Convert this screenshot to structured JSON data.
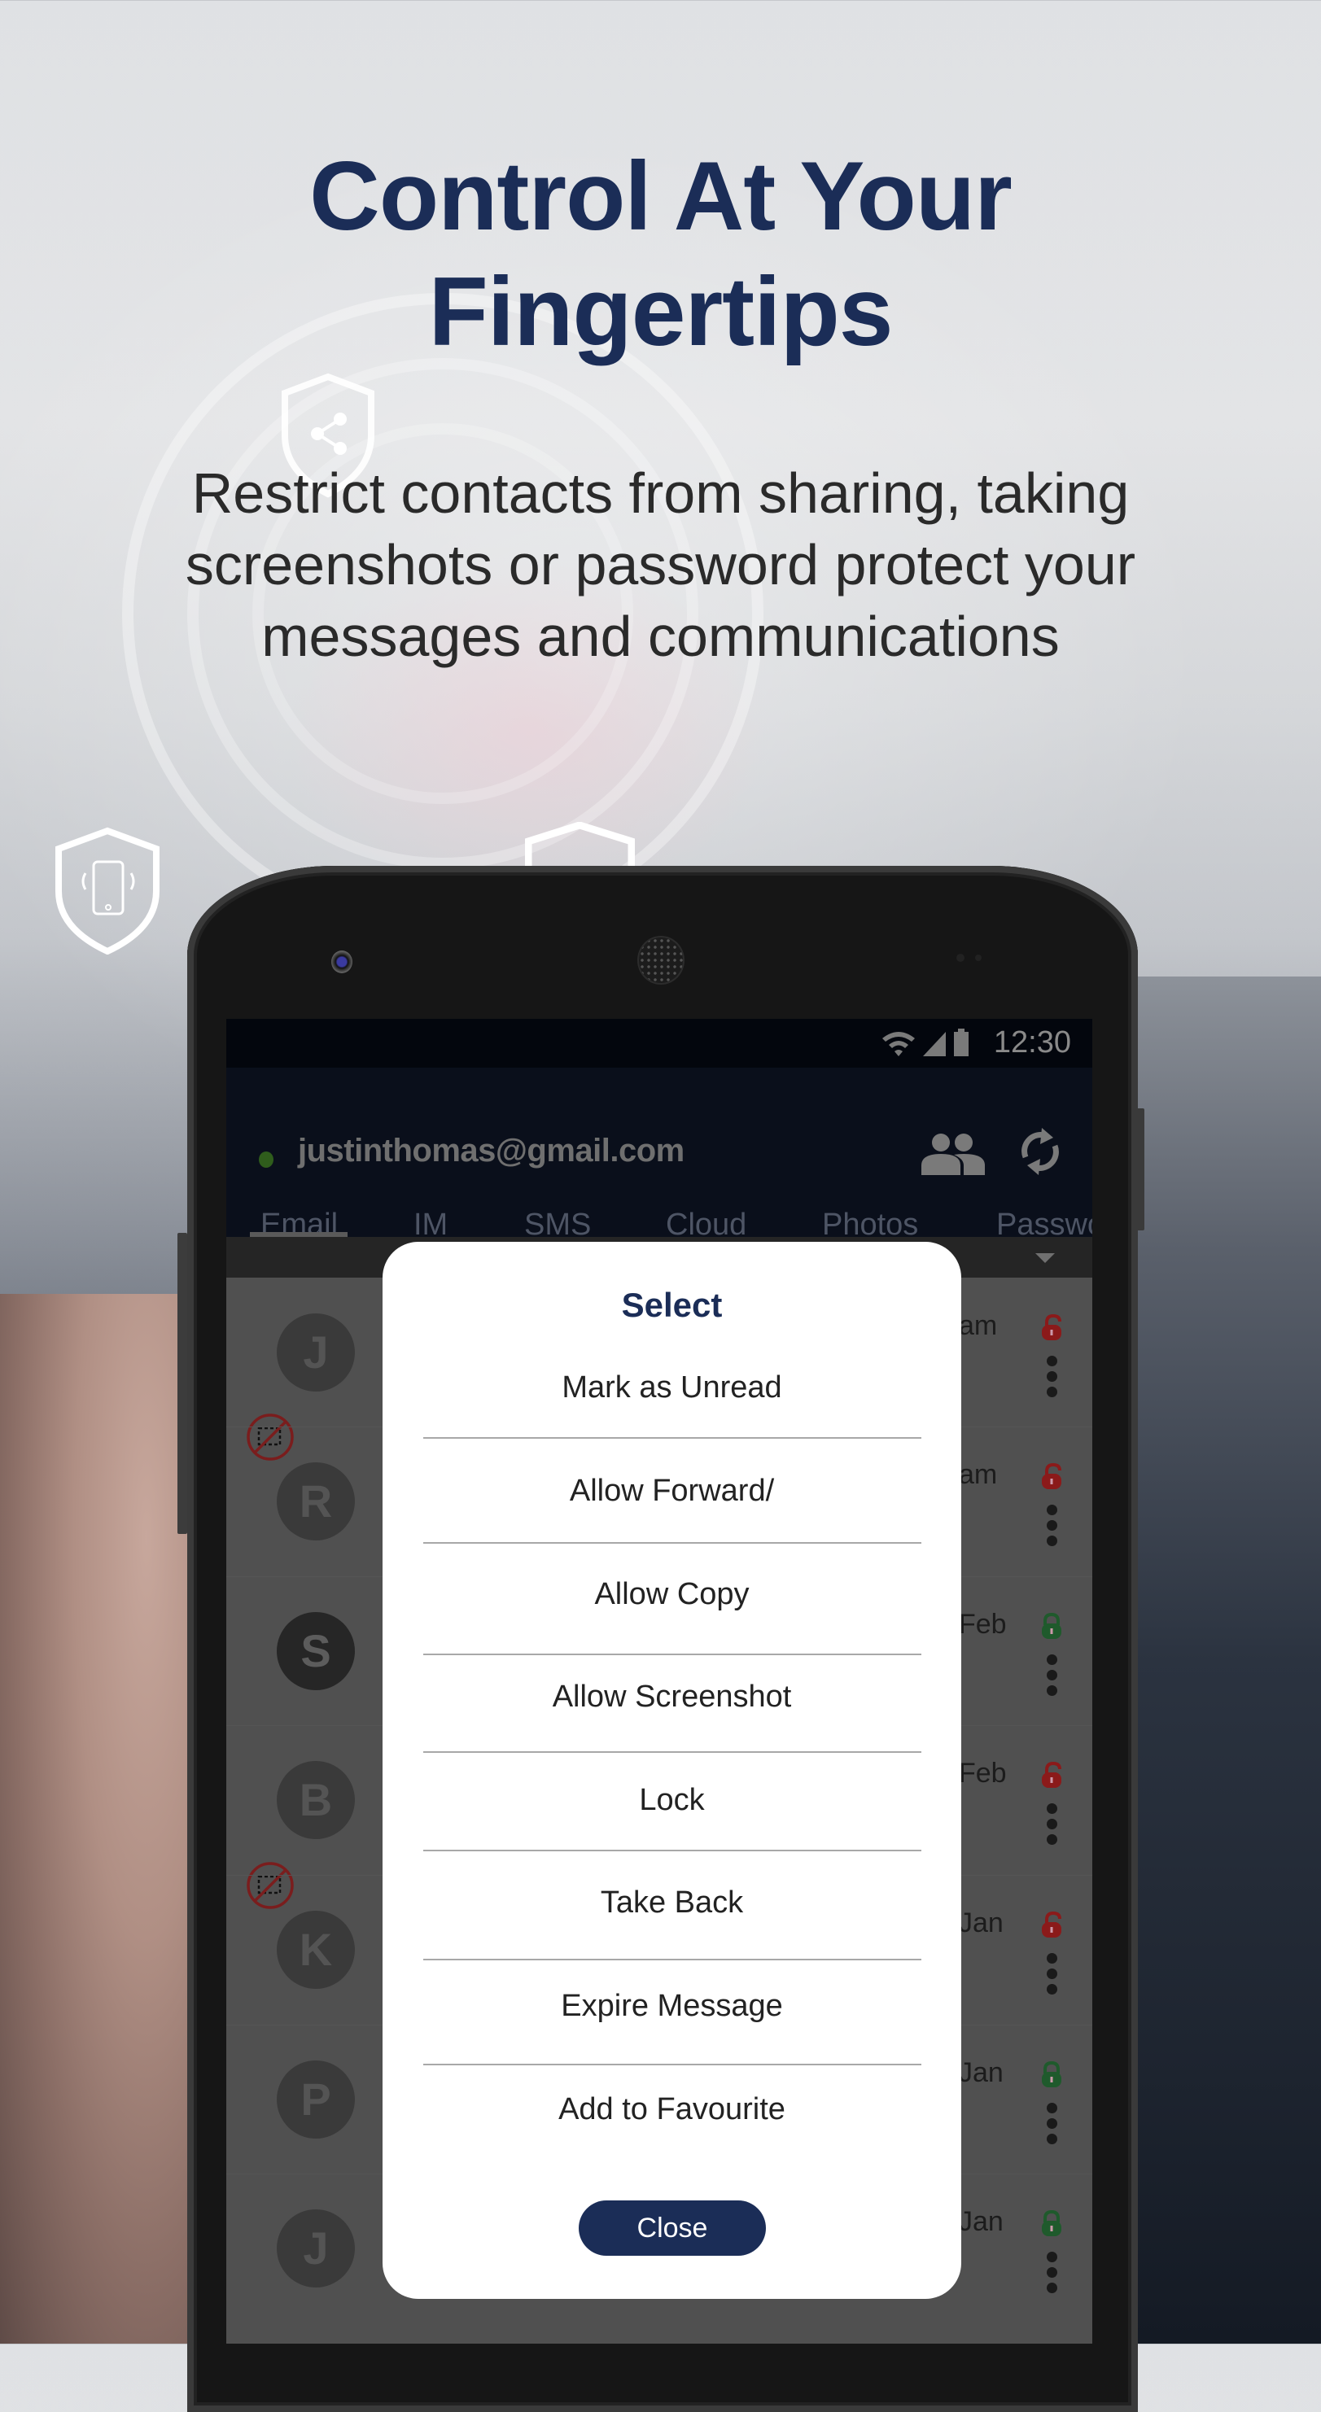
{
  "promo": {
    "headline_line1": "Control At Your",
    "headline_line2": "Fingertips",
    "subtitle_line1": "Restrict contacts from sharing, taking",
    "subtitle_line2": "screenshots or password protect your",
    "subtitle_line3": "messages and communications"
  },
  "colors": {
    "brand_navy": "#1b2d57",
    "lock_open": "#8b1a1a",
    "lock_closed": "#1f5a2c",
    "online_dot": "#2f5d1c"
  },
  "status_bar": {
    "time": "12:30",
    "icons": [
      "wifi-icon",
      "signal-icon",
      "battery-icon"
    ]
  },
  "app_bar": {
    "account": "justinthomas@gmail.com",
    "actions": [
      "contacts-icon",
      "sync-icon"
    ]
  },
  "tabs": [
    {
      "label": "Email",
      "active": true
    },
    {
      "label": "IM"
    },
    {
      "label": "SMS"
    },
    {
      "label": "Cloud"
    },
    {
      "label": "Photos"
    },
    {
      "label": "Passwo"
    }
  ],
  "messages": [
    {
      "initial": "J",
      "date": "am",
      "lock": "open",
      "screenshot_blocked": false
    },
    {
      "initial": "R",
      "date": "am",
      "lock": "open",
      "screenshot_blocked": true
    },
    {
      "initial": "S",
      "date": "Feb",
      "lock": "closed",
      "screenshot_blocked": false
    },
    {
      "initial": "B",
      "date": "Feb",
      "lock": "open",
      "screenshot_blocked": false
    },
    {
      "initial": "K",
      "date": "Jan",
      "lock": "open",
      "screenshot_blocked": true
    },
    {
      "initial": "P",
      "date": "Jan",
      "lock": "closed",
      "screenshot_blocked": false
    },
    {
      "initial": "J",
      "date": "Jan",
      "lock": "closed",
      "screenshot_blocked": false
    }
  ],
  "dialog": {
    "title": "Select",
    "options": [
      "Mark as Unread",
      "Allow Forward/",
      "Allow Copy",
      "Allow Screenshot",
      "Lock",
      "Take Back",
      "Expire Message",
      "Add to Favourite"
    ],
    "close_label": "Close"
  }
}
